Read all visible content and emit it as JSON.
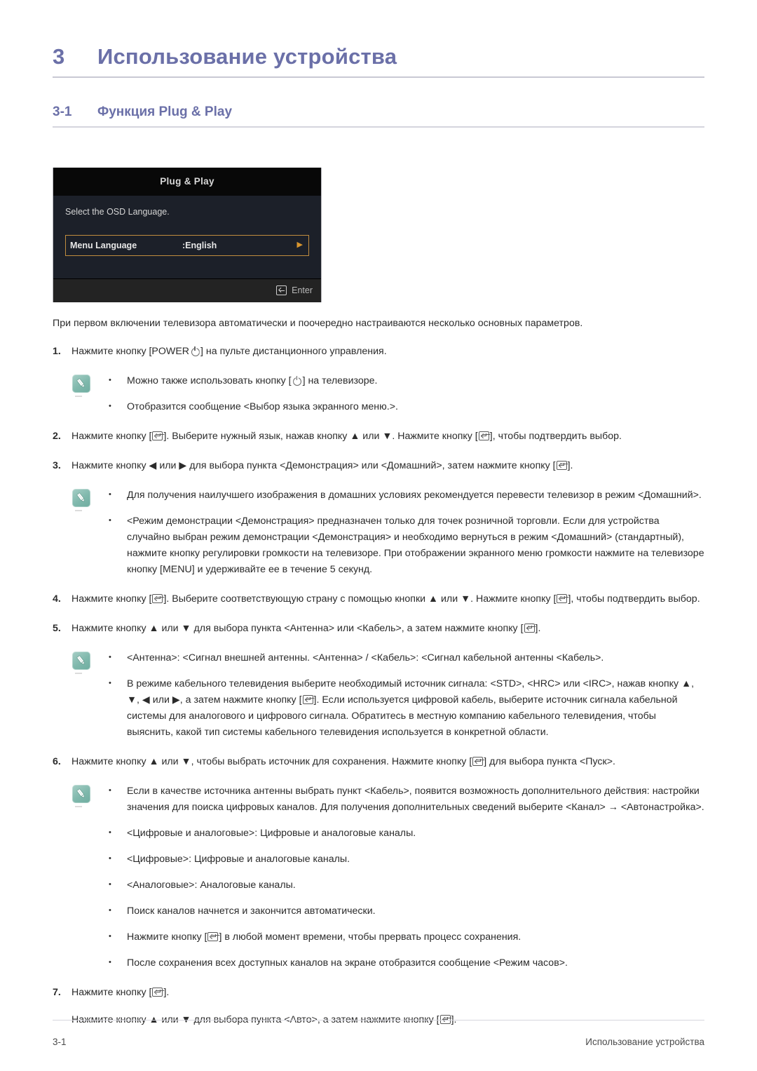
{
  "chapter": {
    "number": "3",
    "title": "Использование устройства"
  },
  "section": {
    "number": "3-1",
    "title": "Функция Plug & Play"
  },
  "osd": {
    "title": "Plug & Play",
    "description": "Select the OSD Language.",
    "row_label": "Menu Language",
    "row_value": ":English",
    "row_arrow": "▶",
    "footer_label": "Enter",
    "highlight_color": "#c08c3e",
    "title_bar_color": "#080808",
    "body_color": "#1c2029",
    "footer_color": "#232323"
  },
  "intro": "При первом включении телевизора автоматически и поочередно настраиваются несколько основных параметров.",
  "steps": {
    "s1": {
      "num": "1.",
      "pre": "Нажмите кнопку [POWER",
      "post": "] на пульте дистанционного управления."
    },
    "s2": {
      "num": "2.",
      "p1": "Нажмите кнопку [",
      "p2": "]. Выберите нужный язык, нажав кнопку ▲ или ▼. Нажмите кнопку [",
      "p3": "], чтобы подтвердить выбор."
    },
    "s3": {
      "num": "3.",
      "p1": "Нажмите кнопку ◀ или ▶ для выбора пункта <Демонстрация> или <Домашний>, затем нажмите кнопку [",
      "p2": "]."
    },
    "s4": {
      "num": "4.",
      "p1": "Нажмите кнопку [",
      "p2": "]. Выберите соответствующую страну с помощью кнопки ▲ или ▼. Нажмите кнопку [",
      "p3": "], чтобы подтвердить выбор."
    },
    "s5": {
      "num": "5.",
      "p1": "Нажмите кнопку ▲ или ▼ для выбора пункта <Антенна> или <Кабель>, а затем нажмите кнопку [",
      "p2": "]."
    },
    "s6": {
      "num": "6.",
      "p1": "Нажмите кнопку ▲ или ▼, чтобы выбрать источник для сохранения. Нажмите кнопку [",
      "p2": "] для выбора пункта <Пуск>."
    },
    "s7": {
      "num": "7.",
      "p1": "Нажмите кнопку [",
      "p2": "].",
      "sub1": "Нажмите кнопку ▲ или ▼ для выбора пункта <Авто>, а затем нажмите кнопку [",
      "sub2": "]."
    }
  },
  "note1": {
    "b1_pre": "Можно также использовать кнопку [",
    "b1_post": "] на телевизоре.",
    "b2": "Отобразится сообщение <Выбор языка экранного меню.>."
  },
  "note2": {
    "b1": "Для получения наилучшего изображения в домашних условиях рекомендуется перевести телевизор в режим <Домашний>.",
    "b2": "<Режим демонстрации <Демонстрация> предназначен только для точек розничной торговли. Если для устройства случайно выбран режим демонстрации <Демонстрация> и необходимо вернуться в режим <Домашний> (стандартный), нажмите кнопку регулировки громкости на телевизоре. При отображении экранного меню громкости нажмите на телевизоре кнопку [MENU] и удерживайте ее в течение 5 секунд."
  },
  "note3": {
    "b1": "<Антенна>: <Сигнал внешней антенны. <Антенна> / <Кабель>: <Сигнал кабельной антенны <Кабель>.",
    "b2_p1": "В режиме кабельного телевидения выберите необходимый источник сигнала: <STD>, <HRC> или <IRC>, нажав кнопку ▲, ▼, ◀ или ▶, а затем нажмите кнопку [",
    "b2_p2": "]. Если используется цифровой кабель, выберите источник сигнала кабельной системы для аналогового и цифрового сигнала. Обратитесь в местную компанию кабельного телевидения, чтобы выяснить, какой тип системы кабельного телевидения используется в конкретной области."
  },
  "note4": {
    "b1": "Если в качестве источника антенны выбрать пункт <Кабель>, появится возможность дополнительного действия: настройки значения для поиска цифровых каналов. Для получения дополнительных сведений выберите <Канал> → <Автонастройка>.",
    "b2": "<Цифровые и аналоговые>: Цифровые и аналоговые каналы.",
    "b3": "<Цифровые>: Цифровые и аналоговые каналы.",
    "b4": "<Аналоговые>: Аналоговые каналы.",
    "b5": "Поиск каналов начнется и закончится автоматически.",
    "b6_p1": "Нажмите кнопку [",
    "b6_p2": "] в любой момент времени, чтобы прервать процесс сохранения.",
    "b7": "После сохранения всех доступных каналов на экране отобразится сообщение <Режим часов>."
  },
  "bullet_char": "•",
  "footer": {
    "left": "3-1",
    "right": "Использование устройства"
  }
}
